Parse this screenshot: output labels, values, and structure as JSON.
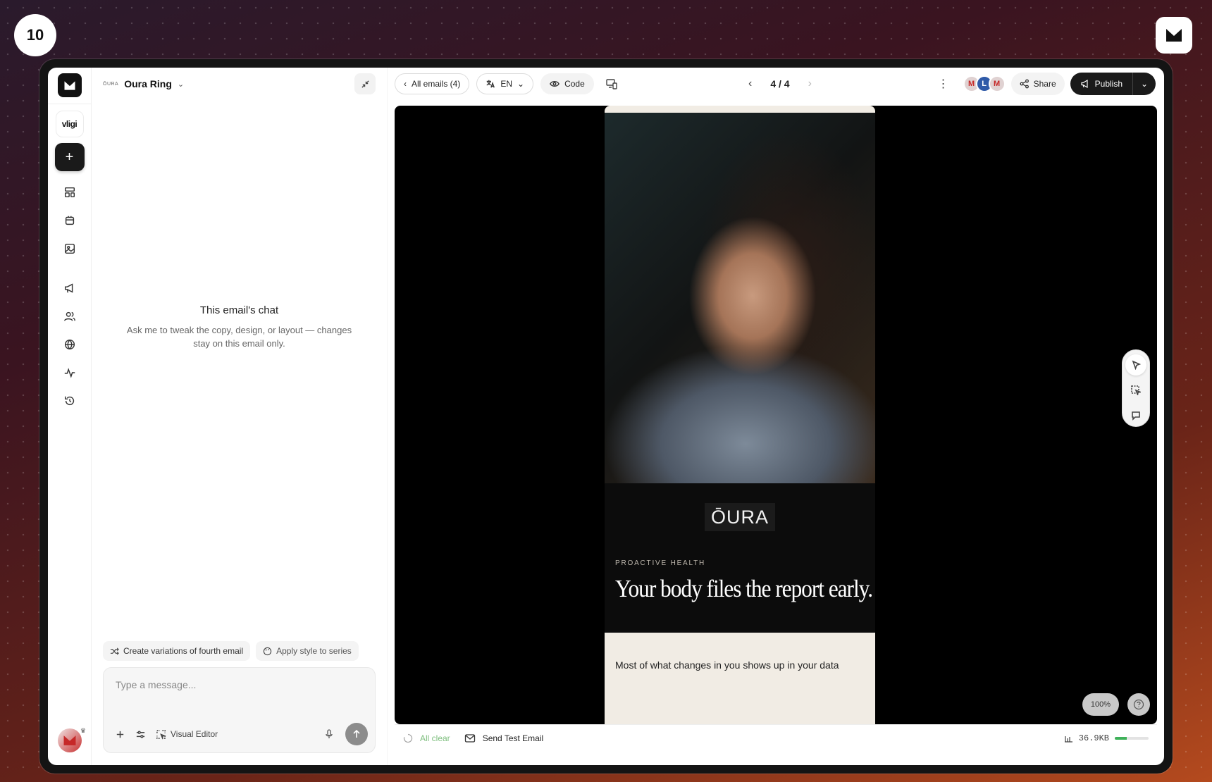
{
  "step": "10",
  "colors": {
    "accent": "#1a1a1a",
    "status_ok": "#7fbf7f",
    "size_fill": "#3fb15a"
  },
  "rail": {
    "workspace_abbrev": "vligi",
    "new_label": "+",
    "icons": [
      "layout-icon",
      "box-icon",
      "image-icon",
      "megaphone-icon",
      "users-icon",
      "globe-icon",
      "activity-icon",
      "history-icon"
    ]
  },
  "chat": {
    "brand_mini": "ŌURA",
    "project_name": "Oura Ring",
    "empty_title": "This email's chat",
    "empty_body": "Ask me to tweak the copy, design, or layout — changes stay on this email only.",
    "suggestions": [
      "Create variations of fourth email",
      "Apply style to series"
    ],
    "composer_placeholder": "Type a message...",
    "composer_value": "",
    "visual_editor_label": "Visual Editor"
  },
  "toolbar": {
    "all_emails_label": "All emails (4)",
    "language": "EN",
    "code_label": "Code",
    "pager": "4 / 4",
    "collaborators": [
      "M",
      "L",
      "M"
    ],
    "share_label": "Share",
    "publish_label": "Publish"
  },
  "email": {
    "logo": "ŌURA",
    "eyebrow": "PROACTIVE HEALTH",
    "headline": "Your body files the report early.",
    "body_start": "Most of what changes in you shows up in your data"
  },
  "canvas": {
    "zoom": "100%"
  },
  "status": {
    "state": "All clear",
    "send_test_label": "Send Test Email",
    "size": "36.9KB",
    "size_fraction": 0.35
  }
}
